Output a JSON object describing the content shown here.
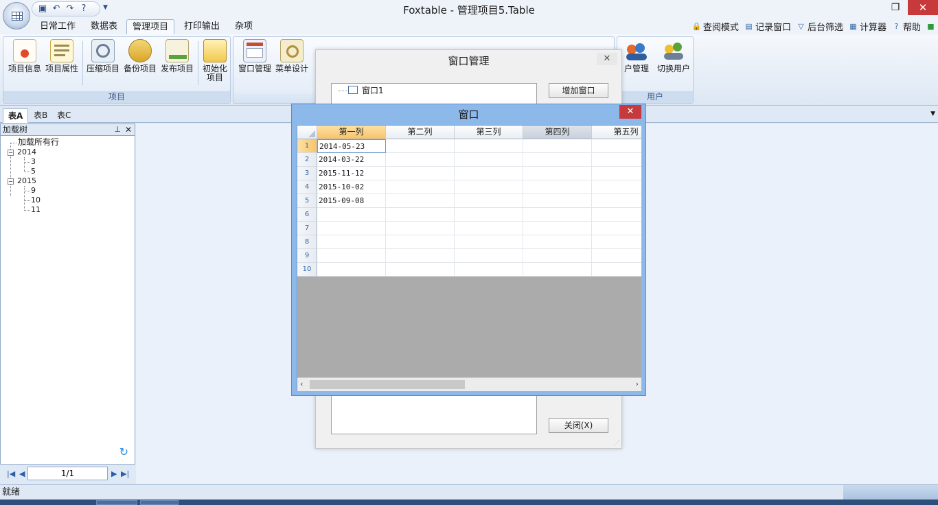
{
  "title": "Foxtable - 管理项目5.Table",
  "tabs": [
    "日常工作",
    "数据表",
    "管理项目",
    "打印输出",
    "杂项"
  ],
  "right_tools": [
    "查阅模式",
    "记录窗口",
    "后台筛选",
    "计算器",
    "帮助"
  ],
  "ribbon": {
    "group_project": {
      "label": "项目",
      "buttons": [
        "项目信息",
        "项目属性",
        "压缩项目",
        "备份项目",
        "发布项目",
        "初始化",
        "项目"
      ]
    },
    "group_design": {
      "buttons": [
        "窗口管理",
        "菜单设计"
      ]
    },
    "group_user": {
      "label": "用户",
      "buttons": [
        "户管理",
        "切换用户"
      ]
    }
  },
  "sheet_tabs": [
    "表A",
    "表B",
    "表C"
  ],
  "tree_panel": {
    "title": "加载树",
    "nodes": [
      "加载所有行",
      "2014",
      "3",
      "5",
      "2015",
      "9",
      "10",
      "11"
    ]
  },
  "nav": {
    "page": "1/1"
  },
  "status": {
    "text": "就绪"
  },
  "window_manager": {
    "title": "窗口管理",
    "items": [
      "窗口1"
    ],
    "add_button": "增加窗口",
    "close_button": "关闭(X)"
  },
  "window": {
    "title": "窗口",
    "columns": [
      "第一列",
      "第二列",
      "第三列",
      "第四列",
      "第五列"
    ],
    "rows": [
      "1",
      "2",
      "3",
      "4",
      "5",
      "6",
      "7",
      "8",
      "9",
      "10"
    ],
    "col1": [
      "2014-05-23",
      "2014-03-22",
      "2015-11-12",
      "2015-10-02",
      "2015-09-08"
    ]
  },
  "colors": {
    "accent": "#2e67a8",
    "close_red": "#c7393a",
    "window_frame": "#8db8ea"
  }
}
